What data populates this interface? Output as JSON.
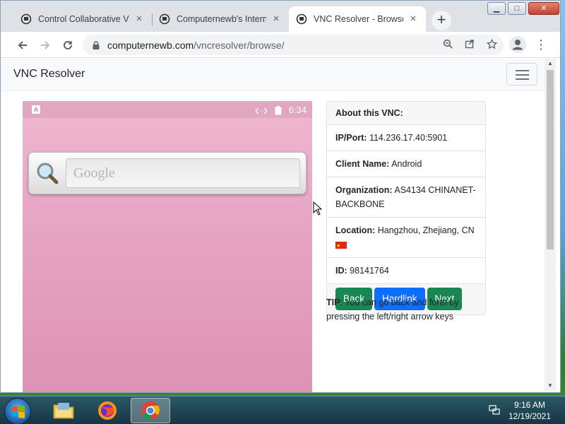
{
  "browser": {
    "tabs": [
      {
        "title": "Control Collaborative Vi",
        "active": false,
        "icon": "shield-favicon-icon"
      },
      {
        "title": "Computernewb's Interne",
        "active": false,
        "icon": "shield-favicon-icon"
      },
      {
        "title": "VNC Resolver - Browse",
        "active": true,
        "icon": "shield-favicon-icon"
      }
    ],
    "close_glyph": "×",
    "new_tab_glyph": "+",
    "url_host": "computernewb.com",
    "url_path": "/vncresolver/browse/",
    "window_controls": {
      "minimize": "▁",
      "maximize": "□",
      "close": "✕"
    }
  },
  "page": {
    "brand": "VNC Resolver",
    "vnc_screen": {
      "status_time": "6:34",
      "status_letter": "A",
      "search_placeholder": "Google",
      "colors": {
        "wallpaper_top": "#f0b8cf",
        "wallpaper_bottom": "#dc92b4"
      }
    },
    "info": {
      "header": "About this VNC:",
      "ip_label": "IP/Port:",
      "ip_value": "114.236.17.40:5901",
      "client_label": "Client Name:",
      "client_value": "Android",
      "org_label": "Organization:",
      "org_value": "AS4134 CHINANET-BACKBONE",
      "location_label": "Location:",
      "location_value": "Hangzhou, Zhejiang, CN",
      "id_label": "ID:",
      "id_value": "98141764"
    },
    "buttons": {
      "back": "Back",
      "hardlink": "Hardlink",
      "next": "Next"
    },
    "tip_label": "TIP",
    "tip_text": ": You can go back and forth by pressing the left/right arrow keys"
  },
  "taskbar": {
    "time": "9:16 AM",
    "date": "12/19/2021",
    "apps": [
      "file-explorer-icon",
      "firefox-icon",
      "chrome-icon"
    ],
    "active_app": "chrome-icon"
  },
  "colors": {
    "green_button": "#198754",
    "blue_button": "#0d6efd",
    "flag_red": "#de2910"
  }
}
